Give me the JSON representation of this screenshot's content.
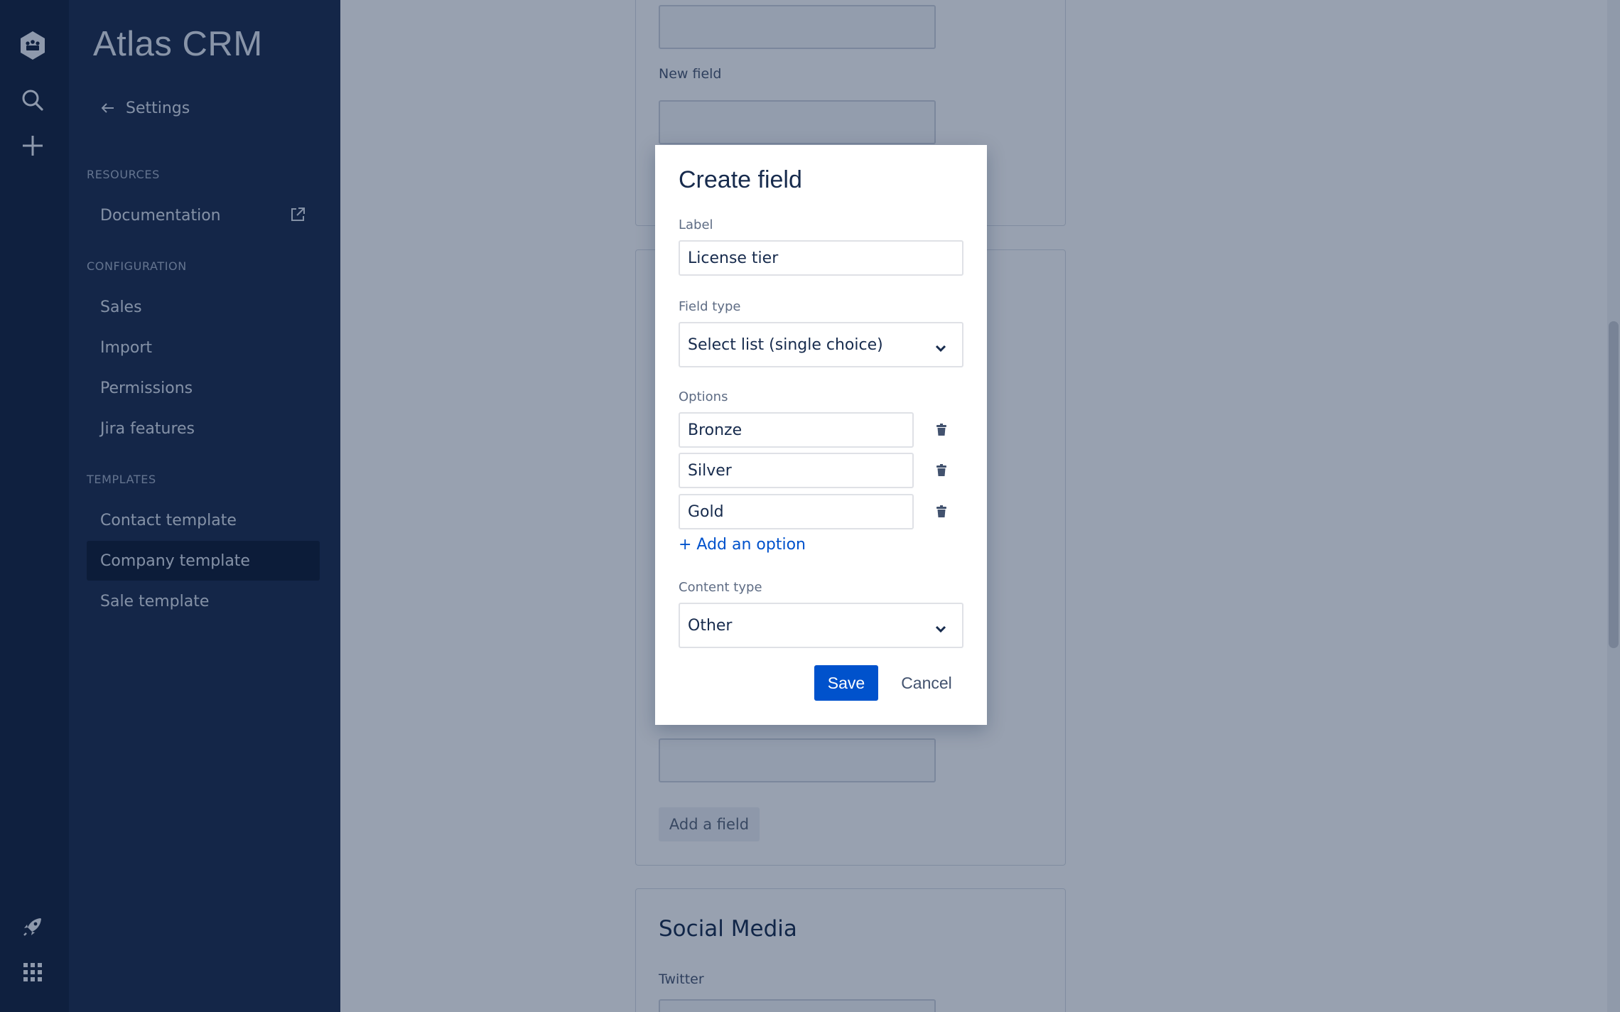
{
  "app": {
    "brand": "Atlas CRM"
  },
  "rail": {
    "icons": [
      "logo-icon",
      "search-icon",
      "plus-icon",
      "rocket-icon",
      "app-grid-icon"
    ]
  },
  "sidebar": {
    "back_label": "Settings",
    "sections": [
      {
        "title": "RESOURCES",
        "items": [
          {
            "label": "Documentation",
            "external": true
          }
        ]
      },
      {
        "title": "CONFIGURATION",
        "items": [
          {
            "label": "Sales"
          },
          {
            "label": "Import"
          },
          {
            "label": "Permissions"
          },
          {
            "label": "Jira features"
          }
        ]
      },
      {
        "title": "TEMPLATES",
        "items": [
          {
            "label": "Contact template"
          },
          {
            "label": "Company template",
            "active": true
          },
          {
            "label": "Sale template"
          }
        ]
      }
    ]
  },
  "main": {
    "field_label_new": "New field",
    "add_field_button": "Add a field",
    "social_media_title": "Social Media",
    "twitter_label": "Twitter"
  },
  "modal": {
    "title": "Create field",
    "label_label": "Label",
    "label_value": "License tier",
    "field_type_label": "Field type",
    "field_type_value": "Select list (single choice)",
    "options_label": "Options",
    "options": [
      "Bronze",
      "Silver",
      "Gold"
    ],
    "add_option": "+ Add an option",
    "content_type_label": "Content type",
    "content_type_value": "Other",
    "save": "Save",
    "cancel": "Cancel"
  },
  "colors": {
    "primary": "#0052cc",
    "sidebar": "#1c2c4d",
    "rail": "#14213d"
  }
}
